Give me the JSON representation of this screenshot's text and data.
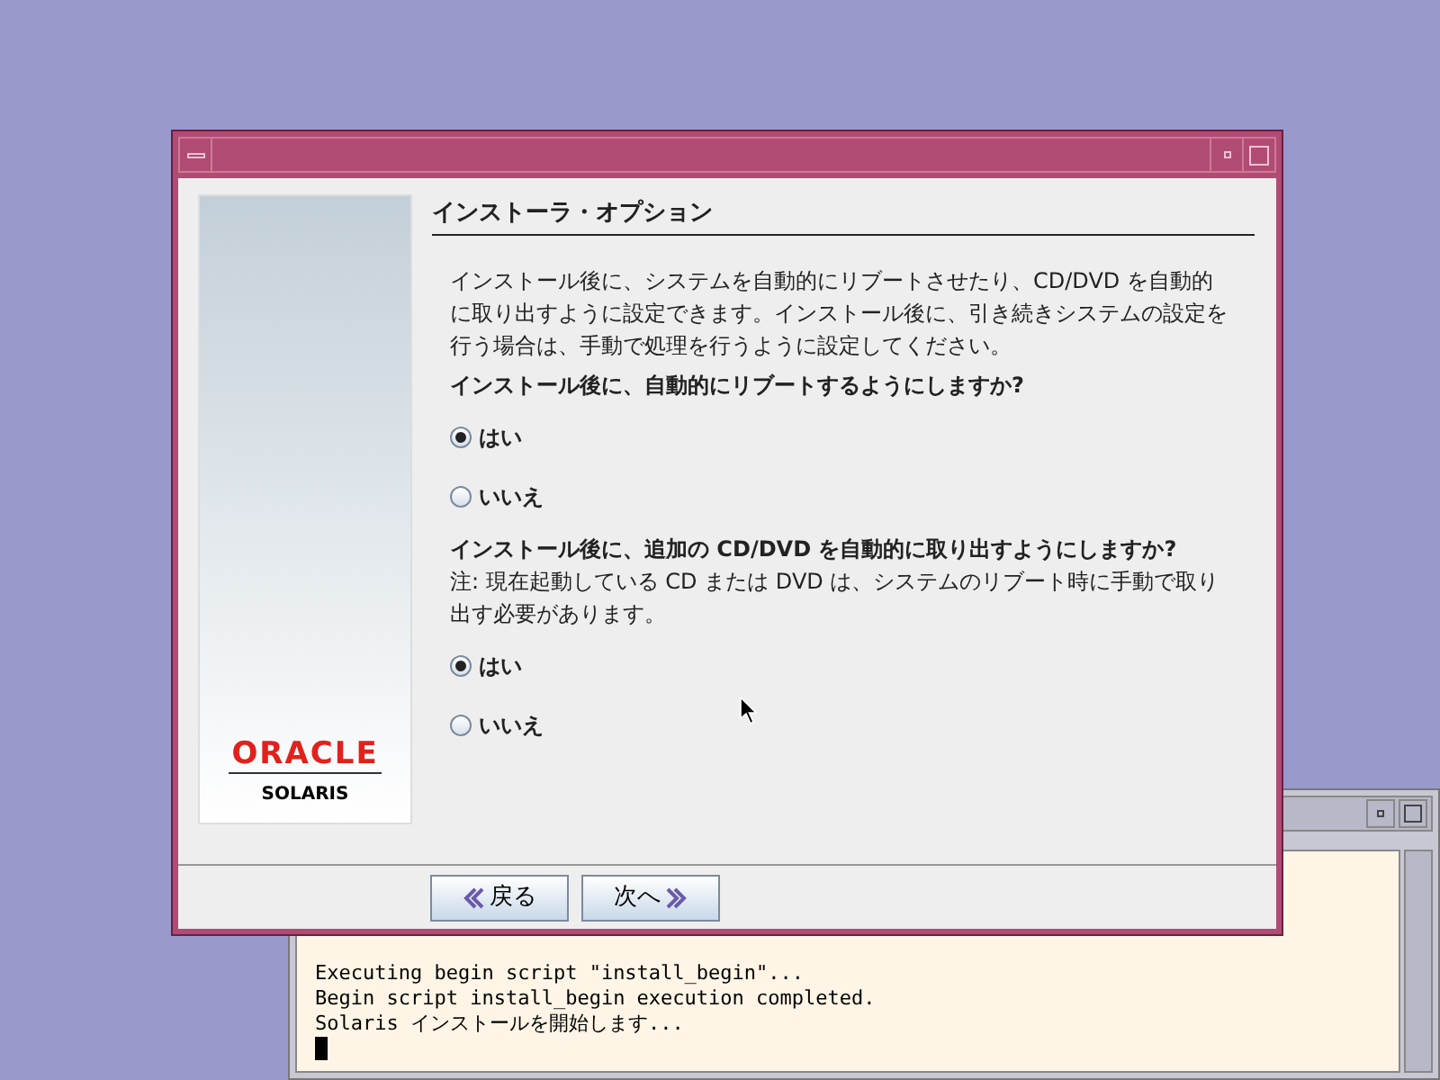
{
  "dialog": {
    "heading": "インストーラ・オプション",
    "intro": "インストール後に、システムを自動的にリブートさせたり、CD/DVD を自動的に取り出すように設定できます。インストール後に、引き続きシステムの設定を行う場合は、手動で処理を行うように設定してください。",
    "questions": [
      {
        "label": "インストール後に、自動的にリブートするようにしますか?",
        "options": [
          {
            "label": "はい",
            "selected": true
          },
          {
            "label": "いいえ",
            "selected": false
          }
        ]
      },
      {
        "label": "インストール後に、追加の CD/DVD を自動的に取り出すようにしますか?",
        "note": "注: 現在起動している CD または DVD は、システムのリブート時に手動で取り出す必要があります。",
        "options": [
          {
            "label": "はい",
            "selected": true
          },
          {
            "label": "いいえ",
            "selected": false
          }
        ]
      }
    ],
    "logo": {
      "brand": "ORACLE",
      "product": "SOLARIS"
    },
    "buttons": [
      {
        "label": "戻る",
        "kind": "back"
      },
      {
        "label": "次へ",
        "kind": "next"
      }
    ]
  },
  "terminal": {
    "lines": [
      "Executing begin script \"install_begin\"...",
      "Begin script install_begin execution completed.",
      "Solaris インストールを開始します..."
    ]
  }
}
